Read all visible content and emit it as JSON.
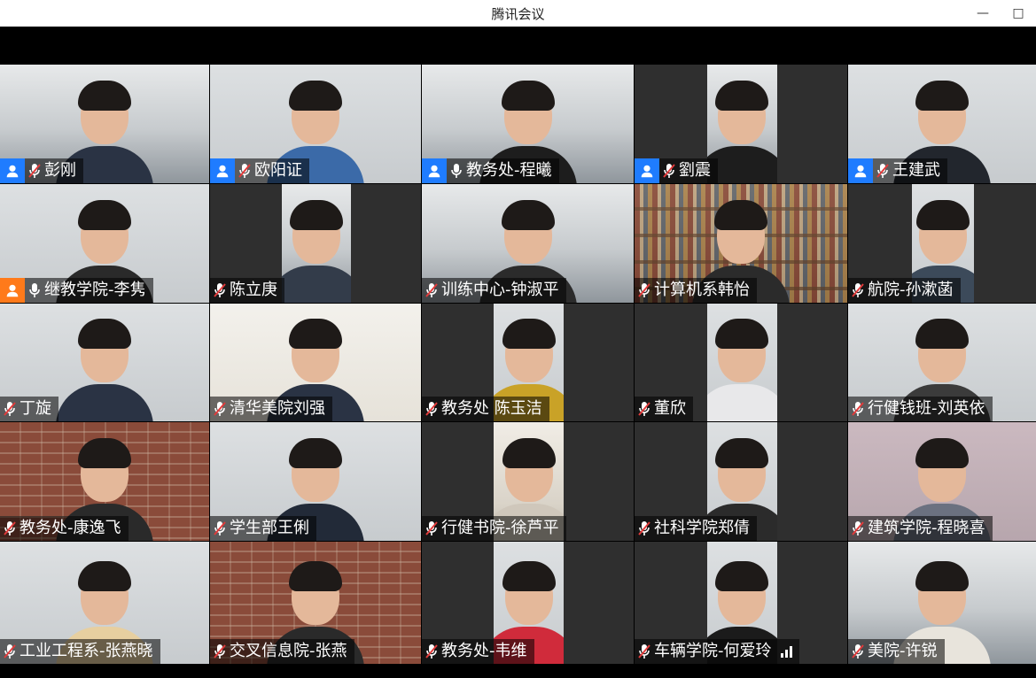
{
  "window": {
    "title": "腾讯会议",
    "minimize_glyph": "—",
    "maximize_glyph": "□"
  },
  "colors": {
    "badge_blue": "#1f7cff",
    "badge_orange": "#ff7a1a",
    "mic_muted": "#e23b3b",
    "active_outline": "#2fbf71"
  },
  "icons": {
    "user_badge": "user-icon",
    "mic": "microphone-icon",
    "mic_muted": "microphone-muted-icon",
    "signal": "signal-strength-icon"
  },
  "participants": [
    {
      "name": "彭刚",
      "badge": "blue",
      "mic": "muted"
    },
    {
      "name": "欧阳证",
      "badge": "blue",
      "mic": "muted"
    },
    {
      "name": "教务处-程曦",
      "badge": "blue",
      "mic": "on",
      "active": true
    },
    {
      "name": "劉震",
      "badge": "blue",
      "mic": "muted"
    },
    {
      "name": "王建武",
      "badge": "blue",
      "mic": "muted"
    },
    {
      "name": "继教学院-李隽",
      "badge": "orange",
      "mic": "on"
    },
    {
      "name": "陈立庚",
      "mic": "muted"
    },
    {
      "name": "训练中心-钟淑平",
      "mic": "muted"
    },
    {
      "name": "计算机系韩怡",
      "mic": "muted"
    },
    {
      "name": "航院-孙漱菡",
      "mic": "muted"
    },
    {
      "name": "丁旋",
      "mic": "muted"
    },
    {
      "name": "清华美院刘强",
      "mic": "muted"
    },
    {
      "name": "教务处 陈玉洁",
      "mic": "muted"
    },
    {
      "name": "董欣",
      "mic": "muted"
    },
    {
      "name": "行健钱班-刘英依",
      "mic": "muted"
    },
    {
      "name": "教务处-康逸飞",
      "mic": "muted"
    },
    {
      "name": "学生部王俐",
      "mic": "muted"
    },
    {
      "name": "行健书院-徐芦平",
      "mic": "muted"
    },
    {
      "name": "社科学院郑倩",
      "mic": "muted"
    },
    {
      "name": "建筑学院-程晓喜",
      "mic": "muted"
    },
    {
      "name": "工业工程系-张燕晓",
      "mic": "muted"
    },
    {
      "name": "交叉信息院-张燕",
      "mic": "muted"
    },
    {
      "name": "教务处-韦维",
      "mic": "muted"
    },
    {
      "name": "车辆学院-何爱玲",
      "mic": "muted",
      "signal": true
    },
    {
      "name": "美院-许锐",
      "mic": "muted"
    }
  ]
}
